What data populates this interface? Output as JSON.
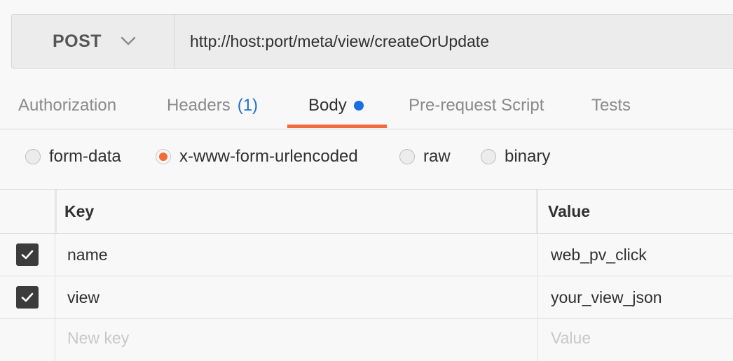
{
  "request": {
    "method": "POST",
    "url": "http://host:port/meta/view/createOrUpdate"
  },
  "tabs": [
    {
      "label": "Authorization"
    },
    {
      "label": "Headers",
      "count": "(1)"
    },
    {
      "label": "Body",
      "active": true
    },
    {
      "label": "Pre-request Script"
    },
    {
      "label": "Tests"
    }
  ],
  "body_types": [
    {
      "label": "form-data",
      "checked": false
    },
    {
      "label": "x-www-form-urlencoded",
      "checked": true
    },
    {
      "label": "raw",
      "checked": false
    },
    {
      "label": "binary",
      "checked": false
    }
  ],
  "table": {
    "key_header": "Key",
    "value_header": "Value",
    "rows": [
      {
        "key": "name",
        "value": "web_pv_click",
        "checked": true
      },
      {
        "key": "view",
        "value": "your_view_json",
        "checked": true
      }
    ],
    "new_key_placeholder": "New key",
    "new_value_placeholder": "Value"
  },
  "colors": {
    "accent": "#f26b3a",
    "dot": "#1a6fe0",
    "count": "#1f6fd1"
  }
}
